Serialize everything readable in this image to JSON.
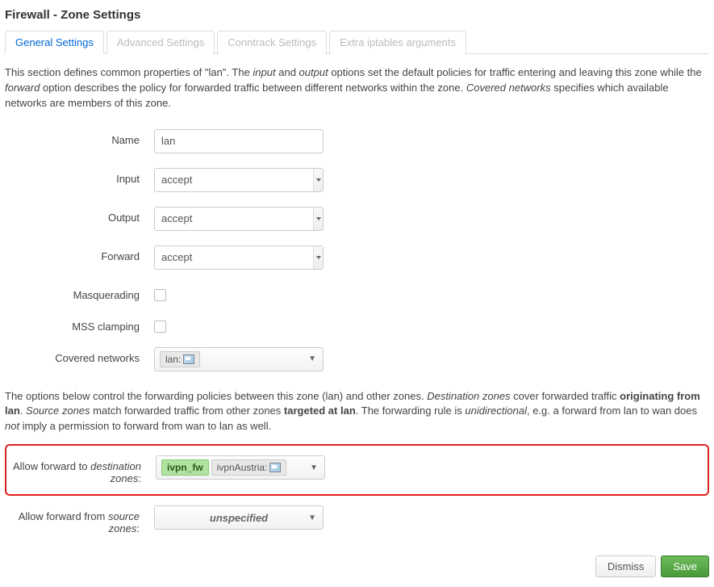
{
  "header": "Firewall - Zone Settings",
  "tabs": {
    "general": "General Settings",
    "advanced": "Advanced Settings",
    "conntrack": "Conntrack Settings",
    "extra": "Extra iptables arguments"
  },
  "desc": {
    "p1a": "This section defines common properties of \"lan\". The ",
    "p1b": "input",
    "p1c": " and ",
    "p1d": "output",
    "p1e": " options set the default policies for traffic entering and leaving this zone while the ",
    "p1f": "forward",
    "p1g": " option describes the policy for forwarded traffic between different networks within the zone. ",
    "p1h": "Covered networks",
    "p1i": " specifies which available networks are members of this zone."
  },
  "form": {
    "name_label": "Name",
    "name_value": "lan",
    "input_label": "Input",
    "input_value": "accept",
    "output_label": "Output",
    "output_value": "accept",
    "forward_label": "Forward",
    "forward_value": "accept",
    "masq_label": "Masquerading",
    "mss_label": "MSS clamping",
    "covered_label": "Covered networks",
    "covered_value": "lan:"
  },
  "desc2": {
    "a": "The options below control the forwarding policies between this zone (lan) and other zones. ",
    "b": "Destination zones",
    "c": " cover forwarded traffic ",
    "d": "originating from lan",
    "e": ". ",
    "f": "Source zones",
    "g": " match forwarded traffic from other zones ",
    "h": "targeted at lan",
    "i": ". The forwarding rule is ",
    "j": "unidirectional",
    "k": ", e.g. a forward from lan to wan does ",
    "l": "not",
    "m": " imply a permission to forward from wan to lan as well."
  },
  "fwd": {
    "to_label_a": "Allow forward to ",
    "to_label_b": "destination zones",
    "to_label_c": ":",
    "to_tag1": "ivpn_fw",
    "to_tag2": "ivpnAustria:",
    "from_label_a": "Allow forward from ",
    "from_label_b": "source zones",
    "from_label_c": ":",
    "from_value": "unspecified"
  },
  "footer": {
    "dismiss": "Dismiss",
    "save": "Save"
  }
}
